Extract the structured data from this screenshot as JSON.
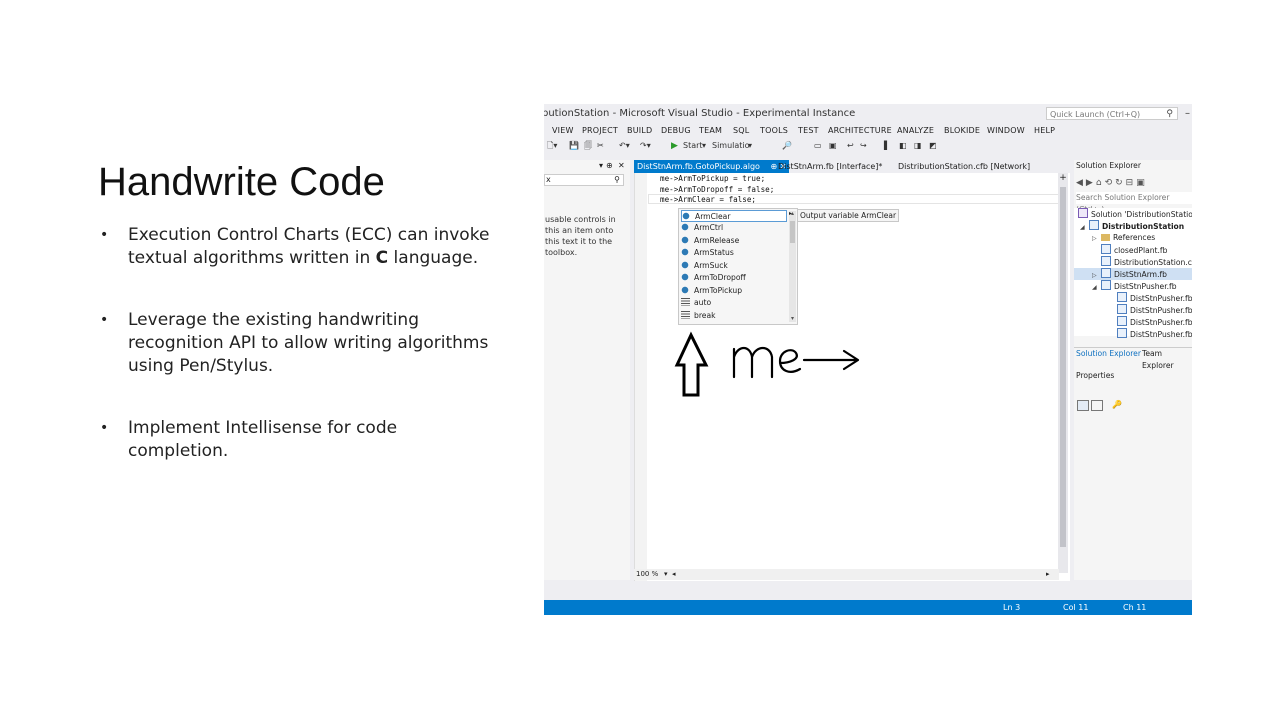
{
  "slide": {
    "title": "Handwrite Code",
    "bullets": [
      {
        "before": "Execution Control Charts (ECC) can invoke textual algorithms written in ",
        "bold": "C",
        "after": " language."
      },
      {
        "text": "Leverage the existing handwriting recognition API to allow writing algorithms using Pen/Stylus."
      },
      {
        "text": "Implement Intellisense for code completion."
      }
    ]
  },
  "vs": {
    "window_title": "butionStation - Microsoft Visual Studio - Experimental Instance",
    "quick_launch_placeholder": "Quick Launch (Ctrl+Q)",
    "menu": [
      "VIEW",
      "PROJECT",
      "BUILD",
      "DEBUG",
      "TEAM",
      "SQL",
      "TOOLS",
      "TEST",
      "ARCHITECTURE",
      "ANALYZE",
      "BLOKIDE",
      "WINDOW",
      "HELP"
    ],
    "toolbar": {
      "start_label": "Start",
      "config_label": "Simulatio"
    },
    "toolbox": {
      "search_text": "x",
      "message": "usable controls in this an item onto this text it to the toolbox."
    },
    "tabs": [
      {
        "label": "DistStnArm.fb.GotoPickup.algo",
        "pin": "⊕ ✕",
        "active": true
      },
      {
        "label": "DistStnArm.fb [Interface]*",
        "active": false
      },
      {
        "label": "DistributionStation.cfb [Network]",
        "active": false
      }
    ],
    "code_lines": [
      "me->ArmToPickup = true;",
      "me->ArmToDropoff = false;",
      "me->ArmClear = false;"
    ],
    "intellisense": {
      "items": [
        {
          "label": "ArmClear",
          "kind": "property",
          "selected": true
        },
        {
          "label": "ArmCtrl",
          "kind": "property"
        },
        {
          "label": "ArmRelease",
          "kind": "property"
        },
        {
          "label": "ArmStatus",
          "kind": "property"
        },
        {
          "label": "ArmSuck",
          "kind": "property"
        },
        {
          "label": "ArmToDropoff",
          "kind": "property"
        },
        {
          "label": "ArmToPickup",
          "kind": "property"
        },
        {
          "label": "auto",
          "kind": "keyword"
        },
        {
          "label": "break",
          "kind": "keyword"
        }
      ],
      "tooltip": "Output variable ArmClear"
    },
    "zoom": "100 %",
    "solution_explorer": {
      "title": "Solution Explorer",
      "search_placeholder": "Search Solution Explorer (Ctrl+;)",
      "tree": [
        {
          "label": "Solution 'DistributionStation'",
          "indent": 0,
          "icon": "solution"
        },
        {
          "label": "DistributionStation",
          "indent": 1,
          "icon": "project",
          "exp": "◢",
          "bold": true
        },
        {
          "label": "References",
          "indent": 2,
          "icon": "folder",
          "exp": "▷"
        },
        {
          "label": "closedPlant.fb",
          "indent": 2,
          "icon": "file"
        },
        {
          "label": "DistributionStation.cf",
          "indent": 2,
          "icon": "file"
        },
        {
          "label": "DistStnArm.fb",
          "indent": 2,
          "icon": "file",
          "exp": "▷",
          "selected": true
        },
        {
          "label": "DistStnPusher.fb",
          "indent": 2,
          "icon": "file",
          "exp": "◢"
        },
        {
          "label": "DistStnPusher.fb.",
          "indent": 3,
          "icon": "file"
        },
        {
          "label": "DistStnPusher.fb.",
          "indent": 3,
          "icon": "file"
        },
        {
          "label": "DistStnPusher.fb.",
          "indent": 3,
          "icon": "file"
        },
        {
          "label": "DistStnPusher.fb.",
          "indent": 3,
          "icon": "file"
        }
      ],
      "tabs": [
        "Solution Explorer",
        "Team Explorer"
      ],
      "properties_title": "Properties"
    },
    "status": {
      "ln": "Ln 3",
      "col": "Col 11",
      "ch": "Ch 11"
    }
  },
  "handwriting": {
    "text": "me→"
  }
}
